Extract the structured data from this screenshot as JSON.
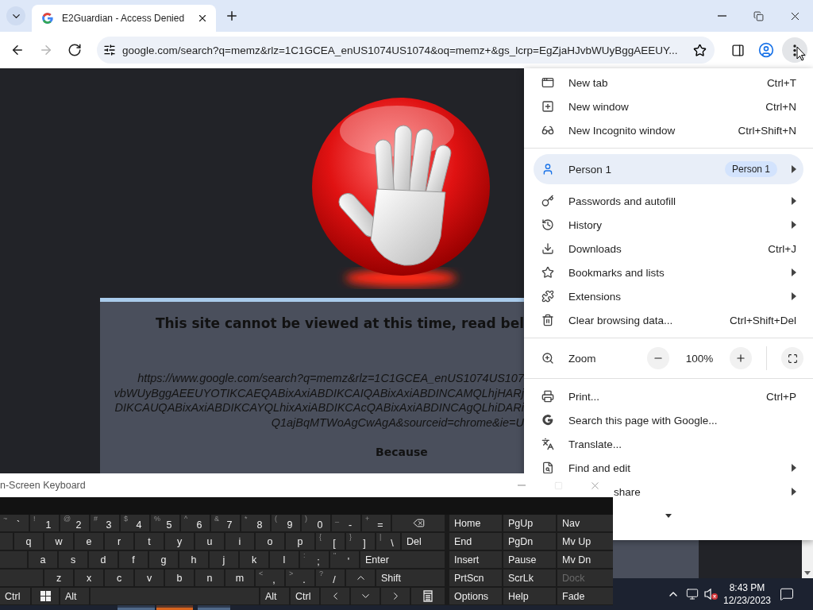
{
  "browser": {
    "tabs": [
      {
        "title": "E2Guardian - Access Denied",
        "selected": true
      }
    ],
    "nav_buttons": [
      {
        "kind": "back",
        "disabled": false
      },
      {
        "kind": "forward",
        "disabled": true
      },
      {
        "kind": "reload",
        "disabled": false
      }
    ],
    "address": "google.com/search?q=memz&rlz=1C1GCEA_enUS1074US1074&oq=memz+&gs_lcrp=EgZjaHJvbWUyBggAEEUY...",
    "menu_button": {
      "active": true
    }
  },
  "page": {
    "heading": "This site cannot be viewed at this time, read bel",
    "url_lines": [
      "https://www.google.com/search?q=memz&rlz=1C1GCEA_enUS1074US107",
      "vbWUyBggAEEUYOTIKCAEQABixAxiABDIKCAIQABixAxiABDINCAMQLhjHARj",
      "DIKCAUQABixAxiABDIKCAYQLhixAxiABDIKCAcQABixAxiABDINCAgQLhiDARi",
      "Q1ajBqMTWoAgCwAgA&sourceid=chrome&ie=U"
    ],
    "reason_label": "Because"
  },
  "menu": {
    "groups": [
      [
        {
          "kind": "item",
          "label": "New tab",
          "shortcut": "Ctrl+T",
          "submenu": false
        },
        {
          "kind": "item",
          "label": "New window",
          "shortcut": "Ctrl+N",
          "submenu": false
        },
        {
          "kind": "item",
          "label": "New Incognito window",
          "shortcut": "Ctrl+Shift+N",
          "submenu": false
        }
      ],
      [
        {
          "kind": "profile",
          "label": "Person 1",
          "badge": "Person 1",
          "submenu": true
        },
        {
          "kind": "item",
          "label": "Passwords and autofill",
          "submenu": true
        },
        {
          "kind": "item",
          "label": "History",
          "submenu": true
        },
        {
          "kind": "item",
          "label": "Downloads",
          "shortcut": "Ctrl+J",
          "submenu": false
        },
        {
          "kind": "item",
          "label": "Bookmarks and lists",
          "submenu": true
        },
        {
          "kind": "item",
          "label": "Extensions",
          "submenu": true
        },
        {
          "kind": "item",
          "label": "Clear browsing data...",
          "shortcut": "Ctrl+Shift+Del",
          "submenu": false
        }
      ],
      [
        {
          "kind": "zoom",
          "label": "Zoom",
          "value": "100%",
          "submenu": false
        }
      ],
      [
        {
          "kind": "item",
          "label": "Print...",
          "shortcut": "Ctrl+P",
          "submenu": false
        },
        {
          "kind": "item",
          "label": "Search this page with Google...",
          "submenu": false
        },
        {
          "kind": "item",
          "label": "Translate...",
          "submenu": false
        },
        {
          "kind": "item",
          "label": "Find and edit",
          "submenu": true
        },
        {
          "kind": "cut",
          "label": "share",
          "submenu": true
        }
      ]
    ]
  },
  "keyboard": {
    "title": "n-Screen Keyboard",
    "rows": [
      [
        {
          "kind": "char",
          "shift": "~",
          "label": "`"
        },
        {
          "kind": "char",
          "shift": "!",
          "label": "1"
        },
        {
          "kind": "char",
          "shift": "@",
          "label": "2"
        },
        {
          "kind": "char",
          "shift": "#",
          "label": "3"
        },
        {
          "kind": "char",
          "shift": "$",
          "label": "4"
        },
        {
          "kind": "char",
          "shift": "%",
          "label": "5"
        },
        {
          "kind": "char",
          "shift": "^",
          "label": "6"
        },
        {
          "kind": "char",
          "shift": "&",
          "label": "7"
        },
        {
          "kind": "char",
          "shift": "*",
          "label": "8"
        },
        {
          "kind": "char",
          "shift": "(",
          "label": "9"
        },
        {
          "kind": "char",
          "shift": ")",
          "label": "0"
        },
        {
          "kind": "char",
          "shift": "_",
          "label": "-"
        },
        {
          "kind": "char",
          "shift": "+",
          "label": "="
        },
        {
          "kind": "icon"
        }
      ],
      [
        {
          "kind": "blank"
        },
        {
          "kind": "char",
          "label": "q"
        },
        {
          "kind": "char",
          "label": "w"
        },
        {
          "kind": "char",
          "label": "e"
        },
        {
          "kind": "char",
          "label": "r"
        },
        {
          "kind": "char",
          "label": "t"
        },
        {
          "kind": "char",
          "label": "y"
        },
        {
          "kind": "char",
          "label": "u"
        },
        {
          "kind": "char",
          "label": "i"
        },
        {
          "kind": "char",
          "label": "o"
        },
        {
          "kind": "char",
          "label": "p"
        },
        {
          "kind": "char",
          "shift": "{",
          "label": "["
        },
        {
          "kind": "char",
          "shift": "}",
          "label": "]"
        },
        {
          "kind": "char",
          "shift": "|",
          "label": "\\"
        },
        {
          "kind": "text",
          "label": "Del"
        }
      ],
      [
        {
          "kind": "blank"
        },
        {
          "kind": "char",
          "label": "a"
        },
        {
          "kind": "char",
          "label": "s"
        },
        {
          "kind": "char",
          "label": "d"
        },
        {
          "kind": "char",
          "label": "f"
        },
        {
          "kind": "char",
          "label": "g"
        },
        {
          "kind": "char",
          "label": "h"
        },
        {
          "kind": "char",
          "label": "j"
        },
        {
          "kind": "char",
          "label": "k"
        },
        {
          "kind": "char",
          "label": "l"
        },
        {
          "kind": "char",
          "shift": ":",
          "label": ";"
        },
        {
          "kind": "char",
          "shift": "\"",
          "label": "'"
        },
        {
          "kind": "text",
          "label": "Enter"
        }
      ],
      [
        {
          "kind": "blank"
        },
        {
          "kind": "char",
          "label": "z"
        },
        {
          "kind": "char",
          "label": "x"
        },
        {
          "kind": "char",
          "label": "c"
        },
        {
          "kind": "char",
          "label": "v"
        },
        {
          "kind": "char",
          "label": "b"
        },
        {
          "kind": "char",
          "label": "n"
        },
        {
          "kind": "char",
          "label": "m"
        },
        {
          "kind": "char",
          "shift": "<",
          "label": ","
        },
        {
          "kind": "char",
          "shift": ">",
          "label": "."
        },
        {
          "kind": "char",
          "shift": "?",
          "label": "/"
        },
        {
          "kind": "icon"
        },
        {
          "kind": "text",
          "label": "Shift"
        }
      ],
      [
        {
          "kind": "text",
          "label": "Ctrl"
        },
        {
          "kind": "icon"
        },
        {
          "kind": "text",
          "label": "Alt"
        },
        {
          "kind": "blank"
        },
        {
          "kind": "text",
          "label": "Alt"
        },
        {
          "kind": "text",
          "label": "Ctrl"
        },
        {
          "kind": "icon"
        },
        {
          "kind": "icon"
        },
        {
          "kind": "icon"
        },
        {
          "kind": "icon"
        }
      ]
    ],
    "nav_keys": [
      {
        "label": "Home",
        "disabled": false
      },
      {
        "label": "PgUp",
        "disabled": false
      },
      {
        "label": "Nav",
        "disabled": false
      },
      {
        "label": "End",
        "disabled": false
      },
      {
        "label": "PgDn",
        "disabled": false
      },
      {
        "label": "Mv Up",
        "disabled": false
      },
      {
        "label": "Insert",
        "disabled": false
      },
      {
        "label": "Pause",
        "disabled": false
      },
      {
        "label": "Mv Dn",
        "disabled": false
      },
      {
        "label": "PrtScn",
        "disabled": false
      },
      {
        "label": "ScrLk",
        "disabled": false
      },
      {
        "label": "Dock",
        "disabled": true
      },
      {
        "label": "Options",
        "disabled": false
      },
      {
        "label": "Help",
        "disabled": false
      },
      {
        "label": "Fade",
        "disabled": false
      }
    ]
  },
  "taskbar": {
    "apps": [
      {
        "color": "#50698a"
      },
      {
        "color": "#d8641e"
      },
      {
        "color": "#50698a"
      }
    ],
    "time": "8:43 PM",
    "date": "12/23/2023"
  }
}
